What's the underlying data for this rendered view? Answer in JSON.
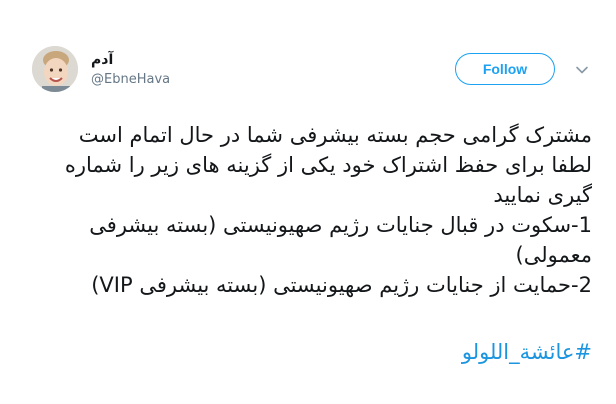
{
  "author": {
    "name": "آدم",
    "handle": "@EbneHava"
  },
  "follow_label": "Follow",
  "tweet": {
    "lines": [
      "مشترک گرامی حجم بسته بیشرفی شما در حال اتمام است",
      "لطفا برای حفظ اشتراک خود یکی از گزینه های زیر را شماره",
      "گیری نمایید",
      "1-سکوت در قبال جنایات رژیم صهیونیستی (بسته بیشرفی",
      "معمولی)",
      "2-حمایت از جنایات رژیم صهیونیستی (بسته بیشرفی VIP)"
    ],
    "hashtag": "#عائشة_اللولو"
  },
  "icons": {
    "avatar": "child-photo",
    "menu": "chevron-down-icon"
  },
  "colors": {
    "accent": "#1da1f2",
    "hashtag": "#1b95e0",
    "text": "#14171a",
    "secondary": "#657786"
  }
}
